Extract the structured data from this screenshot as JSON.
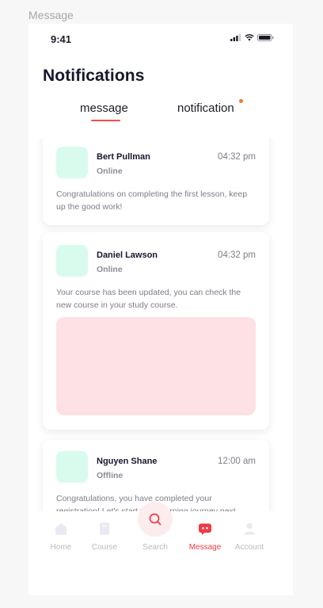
{
  "frame_label": "Message",
  "status_bar": {
    "time": "9:41"
  },
  "page": {
    "title": "Notifications",
    "tabs": [
      {
        "label": "message",
        "active": true
      },
      {
        "label": "notification",
        "has_unread_dot": true
      }
    ]
  },
  "messages": [
    {
      "name": "Bert Pullman",
      "status": "Online",
      "time": "04:32 pm",
      "text": "Congratulations on completing the first lesson, keep up the good work!"
    },
    {
      "name": "Daniel Lawson",
      "status": "Online",
      "time": "04:32 pm",
      "text": "Your course has been updated, you can check the new course in your study course."
    },
    {
      "name": "Nguyen Shane",
      "status": "Offline",
      "time": "12:00 am",
      "text": "Congratulations, you have completed your registration! Let's start your learning journey next."
    }
  ],
  "nav": [
    {
      "label": "Home",
      "icon": "home-icon"
    },
    {
      "label": "Course",
      "icon": "book-icon"
    },
    {
      "label": "Search",
      "icon": "search-icon"
    },
    {
      "label": "Message",
      "icon": "chat-icon",
      "active": true
    },
    {
      "label": "Account",
      "icon": "user-icon"
    }
  ],
  "colors": {
    "accent": "#ef3b47",
    "avatar_bg": "#d9fbee",
    "media_bg": "#fde1e4",
    "notification_dot": "#f27a2a"
  }
}
